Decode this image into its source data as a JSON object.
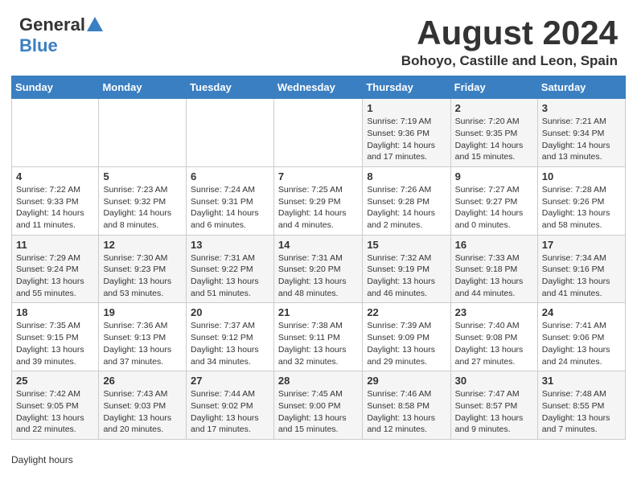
{
  "header": {
    "logo_general": "General",
    "logo_blue": "Blue",
    "title": "August 2024",
    "location": "Bohoyo, Castille and Leon, Spain"
  },
  "weekdays": [
    "Sunday",
    "Monday",
    "Tuesday",
    "Wednesday",
    "Thursday",
    "Friday",
    "Saturday"
  ],
  "weeks": [
    [
      {
        "day": "",
        "info": ""
      },
      {
        "day": "",
        "info": ""
      },
      {
        "day": "",
        "info": ""
      },
      {
        "day": "",
        "info": ""
      },
      {
        "day": "1",
        "info": "Sunrise: 7:19 AM\nSunset: 9:36 PM\nDaylight: 14 hours and 17 minutes."
      },
      {
        "day": "2",
        "info": "Sunrise: 7:20 AM\nSunset: 9:35 PM\nDaylight: 14 hours and 15 minutes."
      },
      {
        "day": "3",
        "info": "Sunrise: 7:21 AM\nSunset: 9:34 PM\nDaylight: 14 hours and 13 minutes."
      }
    ],
    [
      {
        "day": "4",
        "info": "Sunrise: 7:22 AM\nSunset: 9:33 PM\nDaylight: 14 hours and 11 minutes."
      },
      {
        "day": "5",
        "info": "Sunrise: 7:23 AM\nSunset: 9:32 PM\nDaylight: 14 hours and 8 minutes."
      },
      {
        "day": "6",
        "info": "Sunrise: 7:24 AM\nSunset: 9:31 PM\nDaylight: 14 hours and 6 minutes."
      },
      {
        "day": "7",
        "info": "Sunrise: 7:25 AM\nSunset: 9:29 PM\nDaylight: 14 hours and 4 minutes."
      },
      {
        "day": "8",
        "info": "Sunrise: 7:26 AM\nSunset: 9:28 PM\nDaylight: 14 hours and 2 minutes."
      },
      {
        "day": "9",
        "info": "Sunrise: 7:27 AM\nSunset: 9:27 PM\nDaylight: 14 hours and 0 minutes."
      },
      {
        "day": "10",
        "info": "Sunrise: 7:28 AM\nSunset: 9:26 PM\nDaylight: 13 hours and 58 minutes."
      }
    ],
    [
      {
        "day": "11",
        "info": "Sunrise: 7:29 AM\nSunset: 9:24 PM\nDaylight: 13 hours and 55 minutes."
      },
      {
        "day": "12",
        "info": "Sunrise: 7:30 AM\nSunset: 9:23 PM\nDaylight: 13 hours and 53 minutes."
      },
      {
        "day": "13",
        "info": "Sunrise: 7:31 AM\nSunset: 9:22 PM\nDaylight: 13 hours and 51 minutes."
      },
      {
        "day": "14",
        "info": "Sunrise: 7:31 AM\nSunset: 9:20 PM\nDaylight: 13 hours and 48 minutes."
      },
      {
        "day": "15",
        "info": "Sunrise: 7:32 AM\nSunset: 9:19 PM\nDaylight: 13 hours and 46 minutes."
      },
      {
        "day": "16",
        "info": "Sunrise: 7:33 AM\nSunset: 9:18 PM\nDaylight: 13 hours and 44 minutes."
      },
      {
        "day": "17",
        "info": "Sunrise: 7:34 AM\nSunset: 9:16 PM\nDaylight: 13 hours and 41 minutes."
      }
    ],
    [
      {
        "day": "18",
        "info": "Sunrise: 7:35 AM\nSunset: 9:15 PM\nDaylight: 13 hours and 39 minutes."
      },
      {
        "day": "19",
        "info": "Sunrise: 7:36 AM\nSunset: 9:13 PM\nDaylight: 13 hours and 37 minutes."
      },
      {
        "day": "20",
        "info": "Sunrise: 7:37 AM\nSunset: 9:12 PM\nDaylight: 13 hours and 34 minutes."
      },
      {
        "day": "21",
        "info": "Sunrise: 7:38 AM\nSunset: 9:11 PM\nDaylight: 13 hours and 32 minutes."
      },
      {
        "day": "22",
        "info": "Sunrise: 7:39 AM\nSunset: 9:09 PM\nDaylight: 13 hours and 29 minutes."
      },
      {
        "day": "23",
        "info": "Sunrise: 7:40 AM\nSunset: 9:08 PM\nDaylight: 13 hours and 27 minutes."
      },
      {
        "day": "24",
        "info": "Sunrise: 7:41 AM\nSunset: 9:06 PM\nDaylight: 13 hours and 24 minutes."
      }
    ],
    [
      {
        "day": "25",
        "info": "Sunrise: 7:42 AM\nSunset: 9:05 PM\nDaylight: 13 hours and 22 minutes."
      },
      {
        "day": "26",
        "info": "Sunrise: 7:43 AM\nSunset: 9:03 PM\nDaylight: 13 hours and 20 minutes."
      },
      {
        "day": "27",
        "info": "Sunrise: 7:44 AM\nSunset: 9:02 PM\nDaylight: 13 hours and 17 minutes."
      },
      {
        "day": "28",
        "info": "Sunrise: 7:45 AM\nSunset: 9:00 PM\nDaylight: 13 hours and 15 minutes."
      },
      {
        "day": "29",
        "info": "Sunrise: 7:46 AM\nSunset: 8:58 PM\nDaylight: 13 hours and 12 minutes."
      },
      {
        "day": "30",
        "info": "Sunrise: 7:47 AM\nSunset: 8:57 PM\nDaylight: 13 hours and 9 minutes."
      },
      {
        "day": "31",
        "info": "Sunrise: 7:48 AM\nSunset: 8:55 PM\nDaylight: 13 hours and 7 minutes."
      }
    ]
  ],
  "footer": {
    "daylight_label": "Daylight hours"
  }
}
